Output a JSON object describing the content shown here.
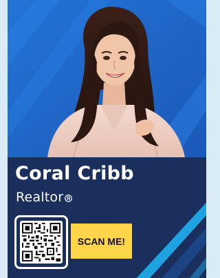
{
  "profile": {
    "name": "Coral Cribb",
    "title": "Realtor"
  },
  "actions": {
    "scan_label": "SCAN ME!"
  },
  "icons": {
    "realtor_badge": "realtor-r-icon",
    "qr": "qr-code-icon"
  },
  "colors": {
    "background": "#d9ecf6",
    "photo_background": "#1f66c4",
    "panel": "#1b2f5c",
    "accent_button": "#ffd54a",
    "accent_stripe": "#1fa3e0",
    "text": "#ffffff"
  }
}
